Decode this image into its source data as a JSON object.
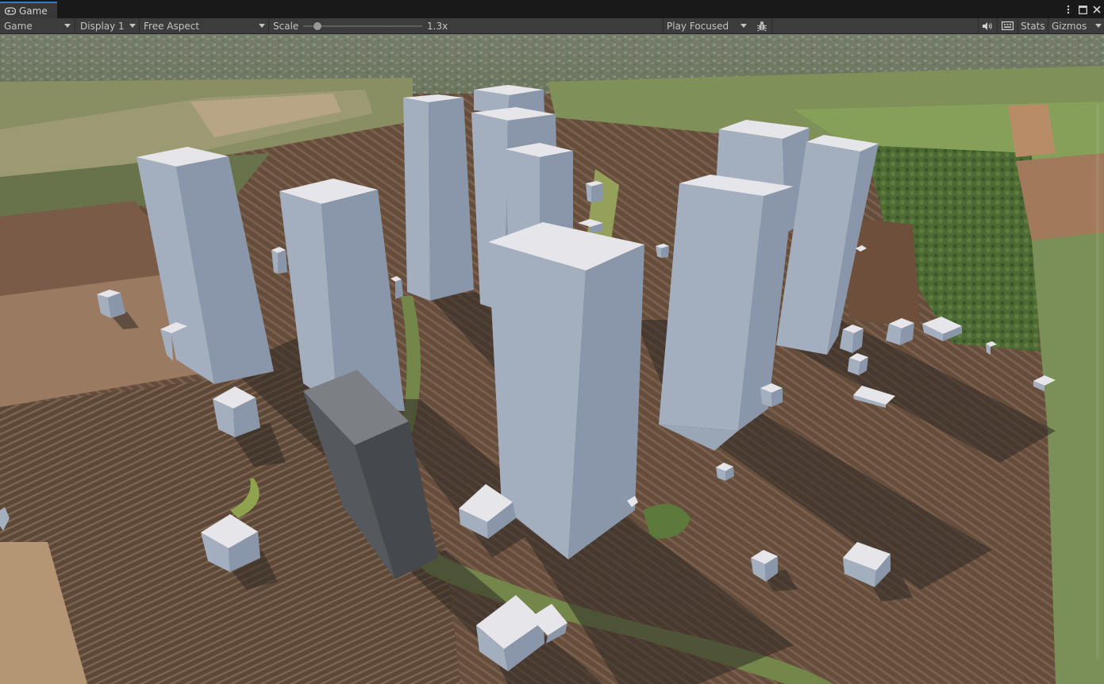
{
  "window": {
    "tab_title": "Game",
    "tab_icon": "gamepad-icon"
  },
  "toolbar": {
    "view_mode": "Game",
    "display": "Display 1",
    "aspect": "Free Aspect",
    "scale_label": "Scale",
    "scale_value": "1.3x",
    "scale_fraction": 0.12,
    "play_mode": "Play Focused",
    "stats": "Stats",
    "gizmos": "Gizmos",
    "icons": [
      "bug-icon",
      "speaker-icon",
      "keyboard-icon",
      "kebab-menu-icon",
      "maximize-icon",
      "close-icon"
    ]
  },
  "scene": {
    "description_colors": {
      "ground_dark": "#5a4536",
      "ground_light": "#7b624f",
      "grass": "#6b8244",
      "box_top": "#e6e6ea",
      "box_left": "#a3aebe",
      "box_right": "#8793a6",
      "selected_box": "#5f6266",
      "shadow": "#2f2a25"
    }
  }
}
